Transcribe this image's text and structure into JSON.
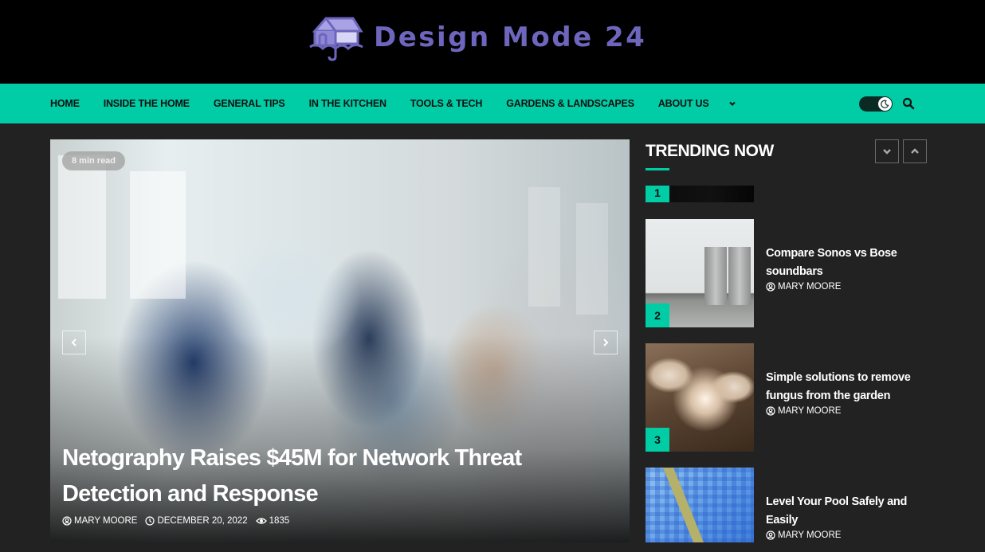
{
  "brand": {
    "name": "Design Mode 24",
    "logo_icon": "umbrella-house-icon",
    "color": "#6e66bd"
  },
  "nav": {
    "items": [
      "HOME",
      "INSIDE THE HOME",
      "GENERAL TIPS",
      "IN THE KITCHEN",
      "TOOLS & TECH",
      "GARDENS & LANDSCAPES",
      "ABOUT US"
    ],
    "more_icon": "chevron-down-icon",
    "dark_mode_icon": "moon-icon",
    "search_icon": "search-icon",
    "accent_color": "#00cca5"
  },
  "hero": {
    "read_time": "8 min read",
    "title": "Netography Raises $45M for Network Threat Detection and Response",
    "author": "MARY MOORE",
    "date": "DECEMBER 20, 2022",
    "views": "1835",
    "prev_icon": "chevron-left-icon",
    "next_icon": "chevron-right-icon"
  },
  "trending": {
    "title": "TRENDING NOW",
    "items": [
      {
        "rank": "1",
        "headline": "",
        "author": ""
      },
      {
        "rank": "2",
        "headline": "Compare Sonos vs Bose soundbars",
        "author": "MARY MOORE"
      },
      {
        "rank": "3",
        "headline": "Simple solutions to remove fungus from the garden",
        "author": "MARY MOORE"
      },
      {
        "rank": "",
        "headline": "Level Your Pool Safely and Easily",
        "author": "MARY MOORE"
      }
    ]
  }
}
